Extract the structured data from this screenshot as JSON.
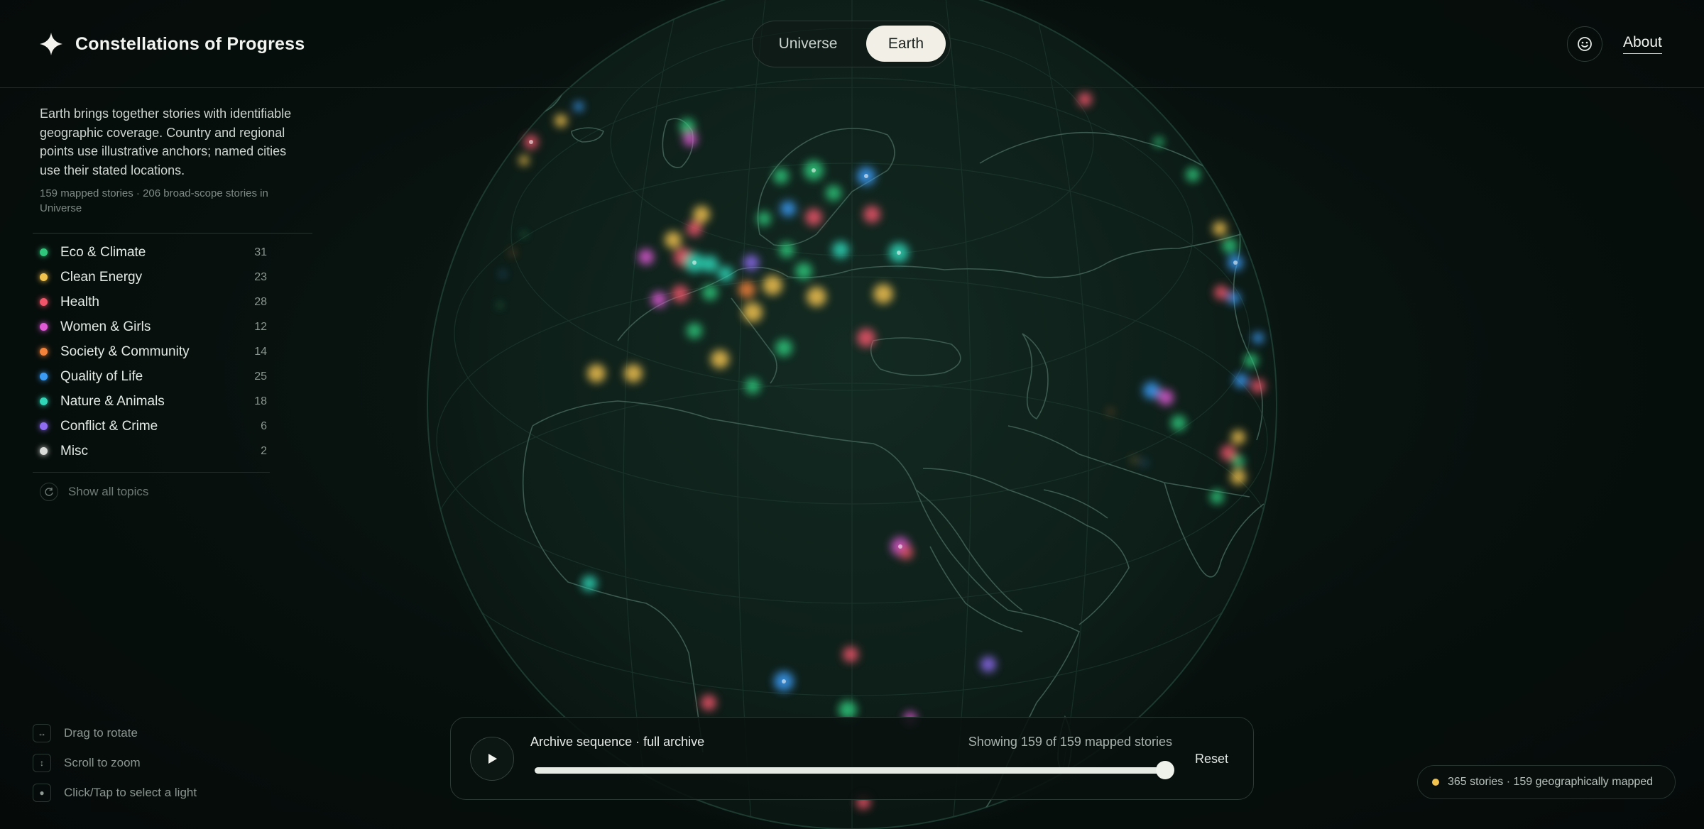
{
  "app": {
    "title": "Constellations of Progress",
    "logo_icon": "sparkle-star-icon"
  },
  "view_toggle": {
    "options": [
      "Universe",
      "Earth"
    ],
    "selected": "Earth"
  },
  "header_actions": {
    "face_icon": "smiley-face-icon",
    "about_label": "About"
  },
  "intro": {
    "text": "Earth brings together stories with identifiable geographic coverage. Country and regional points use illustrative anchors; named cities use their stated locations.",
    "meta": "159 mapped stories · 206 broad-scope stories in Universe"
  },
  "topics": [
    {
      "label": "Eco & Climate",
      "count": "31",
      "color": "#2fc77b"
    },
    {
      "label": "Clean Energy",
      "count": "23",
      "color": "#f2c24f"
    },
    {
      "label": "Health",
      "count": "28",
      "color": "#f0556a"
    },
    {
      "label": "Women & Girls",
      "count": "12",
      "color": "#e05ad6"
    },
    {
      "label": "Society & Community",
      "count": "14",
      "color": "#f5823a"
    },
    {
      "label": "Quality of Life",
      "count": "25",
      "color": "#3b9bf5"
    },
    {
      "label": "Nature & Animals",
      "count": "18",
      "color": "#2fd6b7"
    },
    {
      "label": "Conflict & Crime",
      "count": "6",
      "color": "#8f6cf2"
    },
    {
      "label": "Misc",
      "count": "2",
      "color": "#d9dcd8"
    }
  ],
  "show_all": {
    "label": "Show all topics",
    "icon": "refresh-icon"
  },
  "hints": [
    {
      "label": "Drag to rotate",
      "icon": "horizontal-arrows-icon"
    },
    {
      "label": "Scroll to zoom",
      "icon": "vertical-arrows-icon"
    },
    {
      "label": "Click/Tap to select a light",
      "icon": "dot-icon"
    }
  ],
  "player": {
    "sequence_label": "Archive sequence · full archive",
    "showing_label": "Showing 159 of 159 mapped stories",
    "reset_label": "Reset",
    "progress": 1.0,
    "play_icon": "play-icon"
  },
  "stats": {
    "text": "365 stories · 159 geographically mapped",
    "dot_color": "#f2c24f"
  }
}
